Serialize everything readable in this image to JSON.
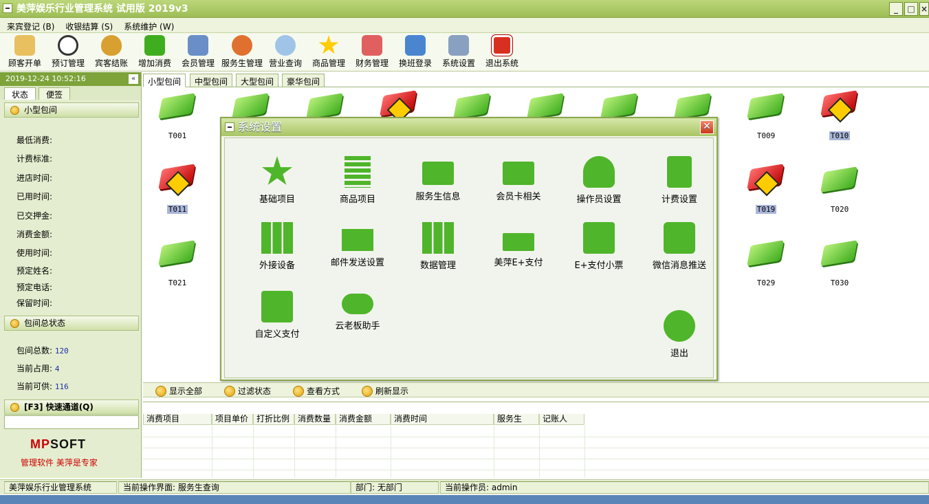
{
  "window": {
    "title": "美萍娱乐行业管理系统 试用版  2019v3"
  },
  "menu": [
    "来宾登记 (B)",
    "收银结算 (S)",
    "系统维护 (W)"
  ],
  "toolbar": [
    {
      "label": "顾客开单",
      "icon": "customer-key-icon"
    },
    {
      "label": "预订管理",
      "icon": "clock-icon"
    },
    {
      "label": "宾客结账",
      "icon": "money-bag-icon"
    },
    {
      "label": "增加消费",
      "icon": "add-consume-icon"
    },
    {
      "label": "会员管理",
      "icon": "member-icon"
    },
    {
      "label": "服务生管理",
      "icon": "waiter-icon"
    },
    {
      "label": "营业查询",
      "icon": "magnifier-icon"
    },
    {
      "label": "商品管理",
      "icon": "star-icon"
    },
    {
      "label": "财务管理",
      "icon": "finance-icon"
    },
    {
      "label": "换班登录",
      "icon": "shift-icon"
    },
    {
      "label": "系统设置",
      "icon": "settings-icon"
    },
    {
      "label": "退出系统",
      "icon": "exit-icon"
    }
  ],
  "left": {
    "datetime": "2019-12-24 10:52:16",
    "tabs": [
      "状态",
      "便签"
    ],
    "room_section": "小型包间",
    "fields": [
      "最低消费:",
      "计费标准:",
      "进店时间:",
      "已用时间:",
      "已交押金:",
      "消费金额:",
      "使用时间:",
      "预定姓名:",
      "预定电话:",
      "保留时间:"
    ],
    "summary_section": "包间总状态",
    "summary": [
      {
        "label": "包间总数:",
        "value": "120"
      },
      {
        "label": "当前占用:",
        "value": "4"
      },
      {
        "label": "当前可供:",
        "value": "116"
      }
    ],
    "quick_section": "[F3] 快速通道(Q)",
    "logo_red": "MP",
    "logo_black": "SOFT",
    "slogan": "管理软件 美萍是专家"
  },
  "room_tabs": [
    "小型包间",
    "中型包间",
    "大型包间",
    "豪华包间"
  ],
  "rooms": [
    {
      "label": "T001",
      "status": "free"
    },
    {
      "label": "T009",
      "status": "free"
    },
    {
      "label": "T010",
      "status": "occupied"
    },
    {
      "label": "T011",
      "status": "occupied"
    },
    {
      "label": "T019",
      "status": "occupied"
    },
    {
      "label": "T020",
      "status": "free"
    },
    {
      "label": "T021",
      "status": "free"
    },
    {
      "label": "T029",
      "status": "free"
    },
    {
      "label": "T030",
      "status": "free"
    }
  ],
  "dialog": {
    "title": "系统设置",
    "items": [
      {
        "label": "基础项目",
        "icon": "star-icon"
      },
      {
        "label": "商品项目",
        "icon": "list-icon"
      },
      {
        "label": "服务生信息",
        "icon": "id-card-icon"
      },
      {
        "label": "会员卡相关",
        "icon": "briefcase-icon"
      },
      {
        "label": "操作员设置",
        "icon": "user-icon"
      },
      {
        "label": "计费设置",
        "icon": "calculator-icon"
      },
      {
        "label": "外接设备",
        "icon": "bar-icon"
      },
      {
        "label": "邮件发送设置",
        "icon": "mail-icon"
      },
      {
        "label": "数据管理",
        "icon": "data-icon"
      },
      {
        "label": "美萍E+支付",
        "icon": "cash-icon"
      },
      {
        "label": "E+支付小票",
        "icon": "printer-icon"
      },
      {
        "label": "微信消息推送",
        "icon": "chat-icon"
      },
      {
        "label": "自定义支付",
        "icon": "custom-pay-icon"
      },
      {
        "label": "云老板助手",
        "icon": "cloud-hand-icon"
      }
    ],
    "exit_label": "退出"
  },
  "actions": [
    "显示全部",
    "过滤状态",
    "查看方式",
    "刷新显示"
  ],
  "grid_columns": [
    "消费项目",
    "项目单价",
    "打折比例",
    "消费数量",
    "消费金额",
    "消费时间",
    "服务生",
    "记账人"
  ],
  "status": [
    "美萍娱乐行业管理系统",
    "当前操作界面: 服务生查询",
    "部门: 无部门",
    "当前操作员: admin"
  ]
}
